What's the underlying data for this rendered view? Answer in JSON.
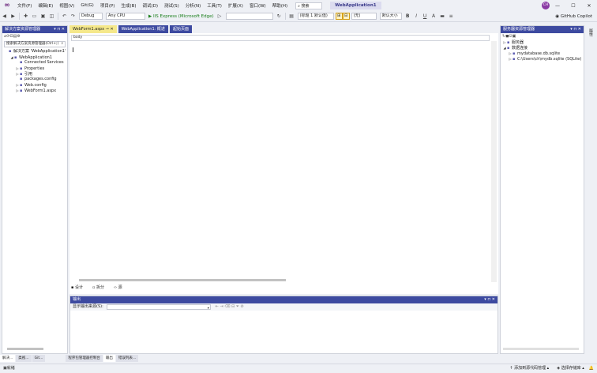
{
  "menubar": {
    "items": [
      "文件(F)",
      "编辑(E)",
      "视图(V)",
      "Git(G)",
      "项目(P)",
      "生成(B)",
      "调试(D)",
      "测试(S)",
      "分析(N)",
      "工具(T)",
      "扩展(X)",
      "窗口(W)",
      "帮助(H)"
    ],
    "search_label": "搜索",
    "solution_name": "WebApplication1",
    "avatar_text": "CH",
    "min": "—",
    "max": "☐",
    "close": "✕"
  },
  "toolbar": {
    "config": "Debug",
    "platform": "Any CPU",
    "run_label": "IIS Express (Microsoft Edge)",
    "block_format": "(标题 1 默认值)",
    "font_size": "(无)",
    "font_family": "默认大小",
    "copilot": "GitHub Copilot"
  },
  "solution_explorer": {
    "title": "解决方案资源管理器",
    "search_placeholder": "搜索解决方案资源管理器(Ctrl+;)",
    "items": [
      {
        "label": "解决方案 'WebApplication1'",
        "indent": 0,
        "arrow": ""
      },
      {
        "label": "WebApplication1",
        "indent": 1,
        "arrow": "◢"
      },
      {
        "label": "Connected Services",
        "indent": 2,
        "arrow": ""
      },
      {
        "label": "Properties",
        "indent": 2,
        "arrow": "▷"
      },
      {
        "label": "引用",
        "indent": 2,
        "arrow": "▷"
      },
      {
        "label": "packages.config",
        "indent": 2,
        "arrow": ""
      },
      {
        "label": "Web.config",
        "indent": 2,
        "arrow": "▷"
      },
      {
        "label": "WebForm1.aspx",
        "indent": 2,
        "arrow": "▷"
      }
    ]
  },
  "editor": {
    "tabs": [
      "WebForm1.aspx",
      "WebApplication1: 概述",
      "起始页面"
    ],
    "active_tab": 0,
    "nav_text": "body",
    "view_tabs": [
      "设计",
      "拆分",
      "源"
    ]
  },
  "output": {
    "title": "输出",
    "source_label": "显示输出来源(S):"
  },
  "team_explorer": {
    "title": "服务器资源管理器",
    "items": [
      {
        "label": "服务器",
        "indent": 0,
        "arrow": "▷"
      },
      {
        "label": "数据连接",
        "indent": 0,
        "arrow": "◢"
      },
      {
        "label": "mydatabase.db.sqlite",
        "indent": 1,
        "arrow": "▷"
      },
      {
        "label": "C:\\Users\\ch\\mydb.sqlite (SQLite)",
        "indent": 1,
        "arrow": "▷"
      }
    ]
  },
  "side_strip": {
    "label": "属性"
  },
  "bottom_tabs": [
    "解决...",
    "类视...",
    "Git...",
    "程序包管理器控制台",
    "输出",
    "错误列表..."
  ],
  "bottom_active": 4,
  "statusbar": {
    "left": "就绪",
    "add_source": "添加到源代码管理",
    "select_repo": "选择存储库"
  }
}
